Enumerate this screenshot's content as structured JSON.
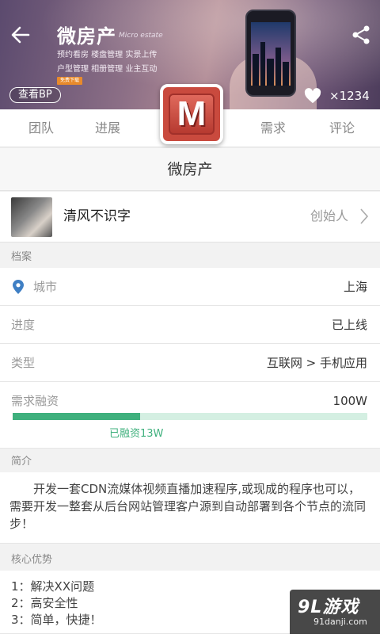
{
  "banner": {
    "app_name": "微房产",
    "app_name_en": "Micro estate",
    "line1": "预约看房  楼盘管理  实景上传",
    "line2": "户型管理  相册管理  业主互动",
    "tag": "免费下载",
    "bp_label": "查看BP",
    "like_count": "×1234"
  },
  "logo_letter": "M",
  "tabs": [
    "团队",
    "进展",
    "需求",
    "评论"
  ],
  "project_title": "微房产",
  "founder": {
    "name": "清风不识字",
    "role": "创始人"
  },
  "archive": {
    "label": "档案",
    "city_label": "城市",
    "city_value": "上海",
    "progress_label": "进度",
    "progress_value": "已上线",
    "type_label": "类型",
    "type_value": "互联网 > 手机应用",
    "funding_label": "需求融资",
    "funding_value": "100W",
    "raised_text": "已融资13W",
    "raised_fraction": 0.36
  },
  "intro": {
    "label": "简介",
    "text": "开发一套CDN流媒体视频直播加速程序,或现成的程序也可以，需要开发一整套从后台网站管理客户源到自动部署到各个节点的流同步！"
  },
  "advantages": {
    "label": "核心优势",
    "items": [
      "1：解决XX问题",
      "2：高安全性",
      "3：简单，快捷！"
    ]
  },
  "watermark": {
    "main": "9L游戏",
    "sub": "91danji.com"
  },
  "colors": {
    "accent_green": "#3fb07d",
    "logo_red": "#c94a3e"
  }
}
